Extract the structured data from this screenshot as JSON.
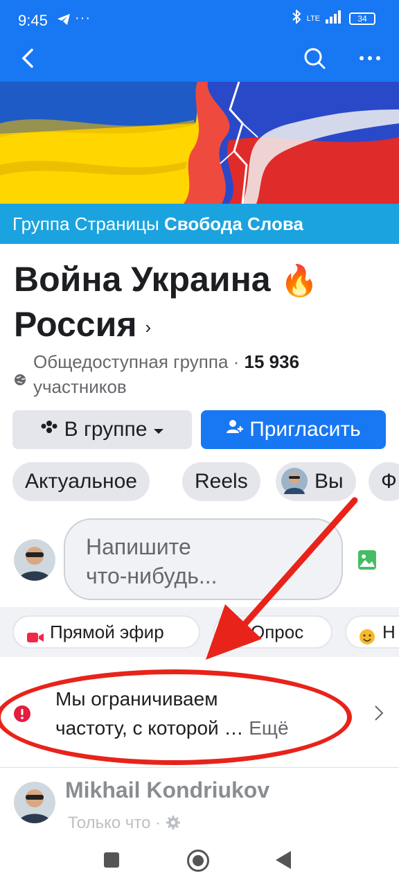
{
  "status": {
    "time": "9:45",
    "dots": "···",
    "network": "LTE",
    "battery": "34"
  },
  "group_bar": {
    "prefix": "Группа Страницы",
    "name": "Свобода Слова"
  },
  "group": {
    "title": "Война Украина",
    "title_emoji": "🔥",
    "title_line2": "Россия",
    "visibility": "Общедоступная группа",
    "separator": " · ",
    "members_count": "15 936",
    "members_label": "участников"
  },
  "buttons": {
    "joined": "В группе",
    "invite": "Пригласить"
  },
  "chips": [
    "Актуальное",
    "Reels",
    "Вы",
    "Ф"
  ],
  "composer": {
    "placeholder_line1": "Напишите",
    "placeholder_line2": "что-нибудь..."
  },
  "actions": [
    "Прямой эфир",
    "Опрос",
    "Н"
  ],
  "notice": {
    "text_line1": "Мы ограничиваем",
    "text_line2": "частоту, с которой … ",
    "more": "Ещё"
  },
  "post": {
    "author": "Mikhail Kondriukov",
    "time": "Только что",
    "dot": " · "
  },
  "colors": {
    "brand": "#1877f2",
    "group_bar": "#1aa3df",
    "annotation_red": "#e8231a"
  }
}
